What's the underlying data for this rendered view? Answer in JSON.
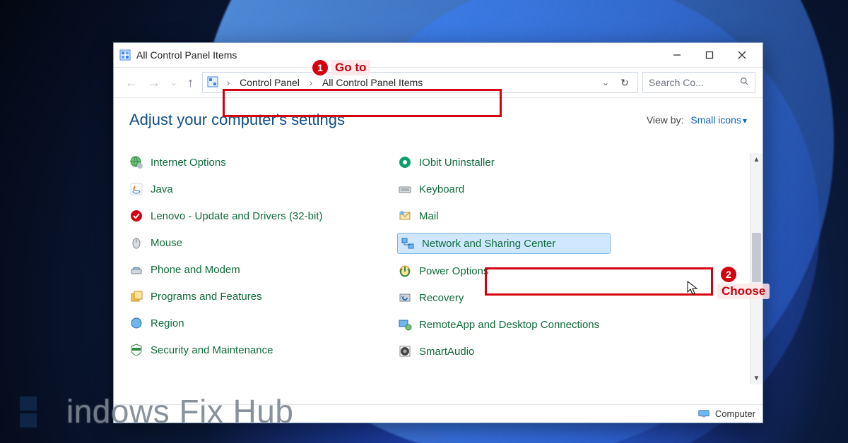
{
  "window": {
    "title": "All Control Panel Items",
    "minimize_tip": "Minimize",
    "maximize_tip": "Maximize",
    "close_tip": "Close"
  },
  "nav": {
    "back_tip": "Back",
    "forward_tip": "Forward",
    "recent_tip": "Recent locations",
    "up_tip": "Up",
    "refresh_tip": "Refresh"
  },
  "breadcrumb": {
    "segments": [
      "Control Panel",
      "All Control Panel Items"
    ]
  },
  "search": {
    "placeholder": "Search Co..."
  },
  "heading": "Adjust your computer's settings",
  "viewby": {
    "label": "View by:",
    "value": "Small icons"
  },
  "items_left": [
    {
      "icon": "globe-gear-icon",
      "label": "Internet Options"
    },
    {
      "icon": "java-icon",
      "label": "Java"
    },
    {
      "icon": "lenovo-icon",
      "label": "Lenovo - Update and Drivers (32-bit)"
    },
    {
      "icon": "mouse-icon",
      "label": "Mouse"
    },
    {
      "icon": "phone-modem-icon",
      "label": "Phone and Modem"
    },
    {
      "icon": "programs-icon",
      "label": "Programs and Features"
    },
    {
      "icon": "region-icon",
      "label": "Region"
    },
    {
      "icon": "security-icon",
      "label": "Security and Maintenance"
    }
  ],
  "items_right": [
    {
      "icon": "iobit-icon",
      "label": "IObit Uninstaller"
    },
    {
      "icon": "keyboard-icon",
      "label": "Keyboard"
    },
    {
      "icon": "mail-icon",
      "label": "Mail"
    },
    {
      "icon": "network-icon",
      "label": "Network and Sharing Center",
      "hover": true
    },
    {
      "icon": "power-icon",
      "label": "Power Options"
    },
    {
      "icon": "recovery-icon",
      "label": "Recovery"
    },
    {
      "icon": "remoteapp-icon",
      "label": "RemoteApp and Desktop Connections"
    },
    {
      "icon": "smartaudio-icon",
      "label": "SmartAudio"
    }
  ],
  "statusbar": {
    "label": "Computer"
  },
  "annotations": {
    "1": {
      "num": "1",
      "label": "Go to"
    },
    "2": {
      "num": "2",
      "label": "Choose"
    }
  },
  "watermark": "indows Fix Hub"
}
